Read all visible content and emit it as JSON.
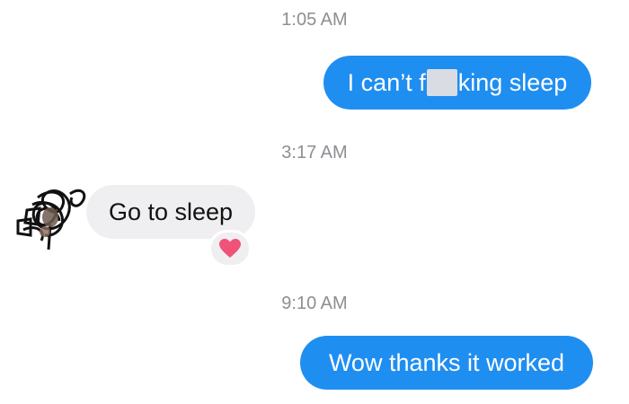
{
  "thread": {
    "timestamp_1": "1:05 AM",
    "timestamp_2": "3:17 AM",
    "timestamp_3": "9:10 AM"
  },
  "messages": [
    {
      "sender": "me",
      "text_before": "I can’t f",
      "text_after": "king sleep"
    },
    {
      "sender": "them",
      "text": "Go to sleep",
      "reaction": "heart-reaction-icon"
    },
    {
      "sender": "me",
      "text": "Wow thanks it worked"
    }
  ],
  "colors": {
    "outgoing_bubble": "#1f8ef1",
    "incoming_bubble": "#efeff1",
    "timestamp": "#8e8e93",
    "heart": "#f0527a"
  }
}
